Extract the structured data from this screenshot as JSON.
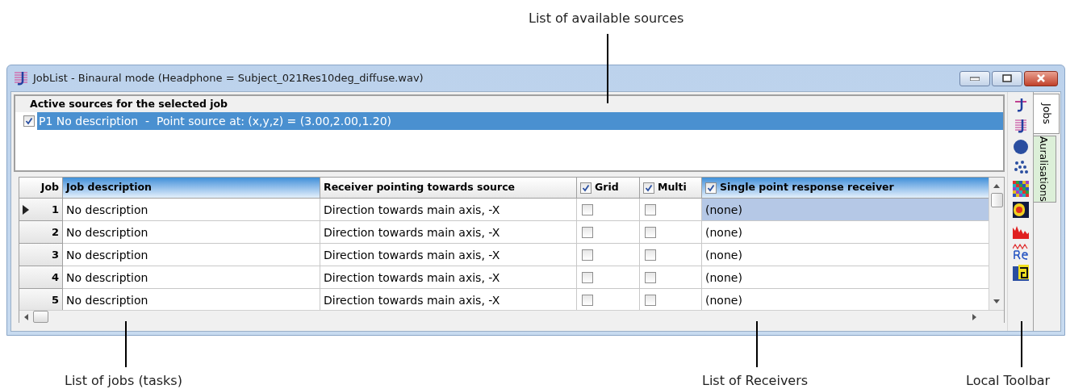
{
  "annotations": [
    {
      "text": "List of available sources",
      "kind": "top"
    },
    {
      "text": "List of jobs (tasks)",
      "kind": "bottom_left"
    },
    {
      "text": "List of Receivers",
      "kind": "bottom_middle"
    },
    {
      "text": "Local Toolbar",
      "kind": "bottom_right"
    }
  ],
  "window": {
    "title": "JobList - Binaural mode (Headphone = Subject_021Res10deg_diffuse.wav)"
  },
  "sources_panel": {
    "title": "Active sources for the selected job",
    "items": [
      {
        "label": "P1 No description  -  Point source at: (x,y,z) = (3.00,2.00,1.20)",
        "checked": true,
        "selected": true
      }
    ]
  },
  "table": {
    "columns": [
      {
        "label": "Job",
        "kind": "plain",
        "selected": false
      },
      {
        "label": "Job description",
        "kind": "plain",
        "selected": true
      },
      {
        "label": "Receiver pointing towards source",
        "kind": "plain",
        "selected": false
      },
      {
        "label": "Grid",
        "kind": "check",
        "checked": true,
        "selected": false
      },
      {
        "label": "Multi",
        "kind": "check",
        "checked": true,
        "selected": false
      },
      {
        "label": "Single point response receiver",
        "kind": "check",
        "checked": true,
        "selected": true
      }
    ],
    "rows": [
      {
        "job": "1",
        "description": "No description",
        "direction": "Direction towards main axis, -X",
        "grid": false,
        "multi": false,
        "receiver": "(none)",
        "selected": true
      },
      {
        "job": "2",
        "description": "No description",
        "direction": "Direction towards main axis, -X",
        "grid": false,
        "multi": false,
        "receiver": "(none)",
        "selected": false
      },
      {
        "job": "3",
        "description": "No description",
        "direction": "Direction towards main axis, -X",
        "grid": false,
        "multi": false,
        "receiver": "(none)",
        "selected": false
      },
      {
        "job": "4",
        "description": "No description",
        "direction": "Direction towards main axis, -X",
        "grid": false,
        "multi": false,
        "receiver": "(none)",
        "selected": false
      },
      {
        "job": "5",
        "description": "No description",
        "direction": "Direction towards main axis, -X",
        "grid": false,
        "multi": false,
        "receiver": "(none)",
        "selected": false
      }
    ]
  },
  "side_tabs": [
    {
      "label": "Jobs",
      "selected": true
    },
    {
      "label": "Auralisations",
      "selected": false
    }
  ]
}
